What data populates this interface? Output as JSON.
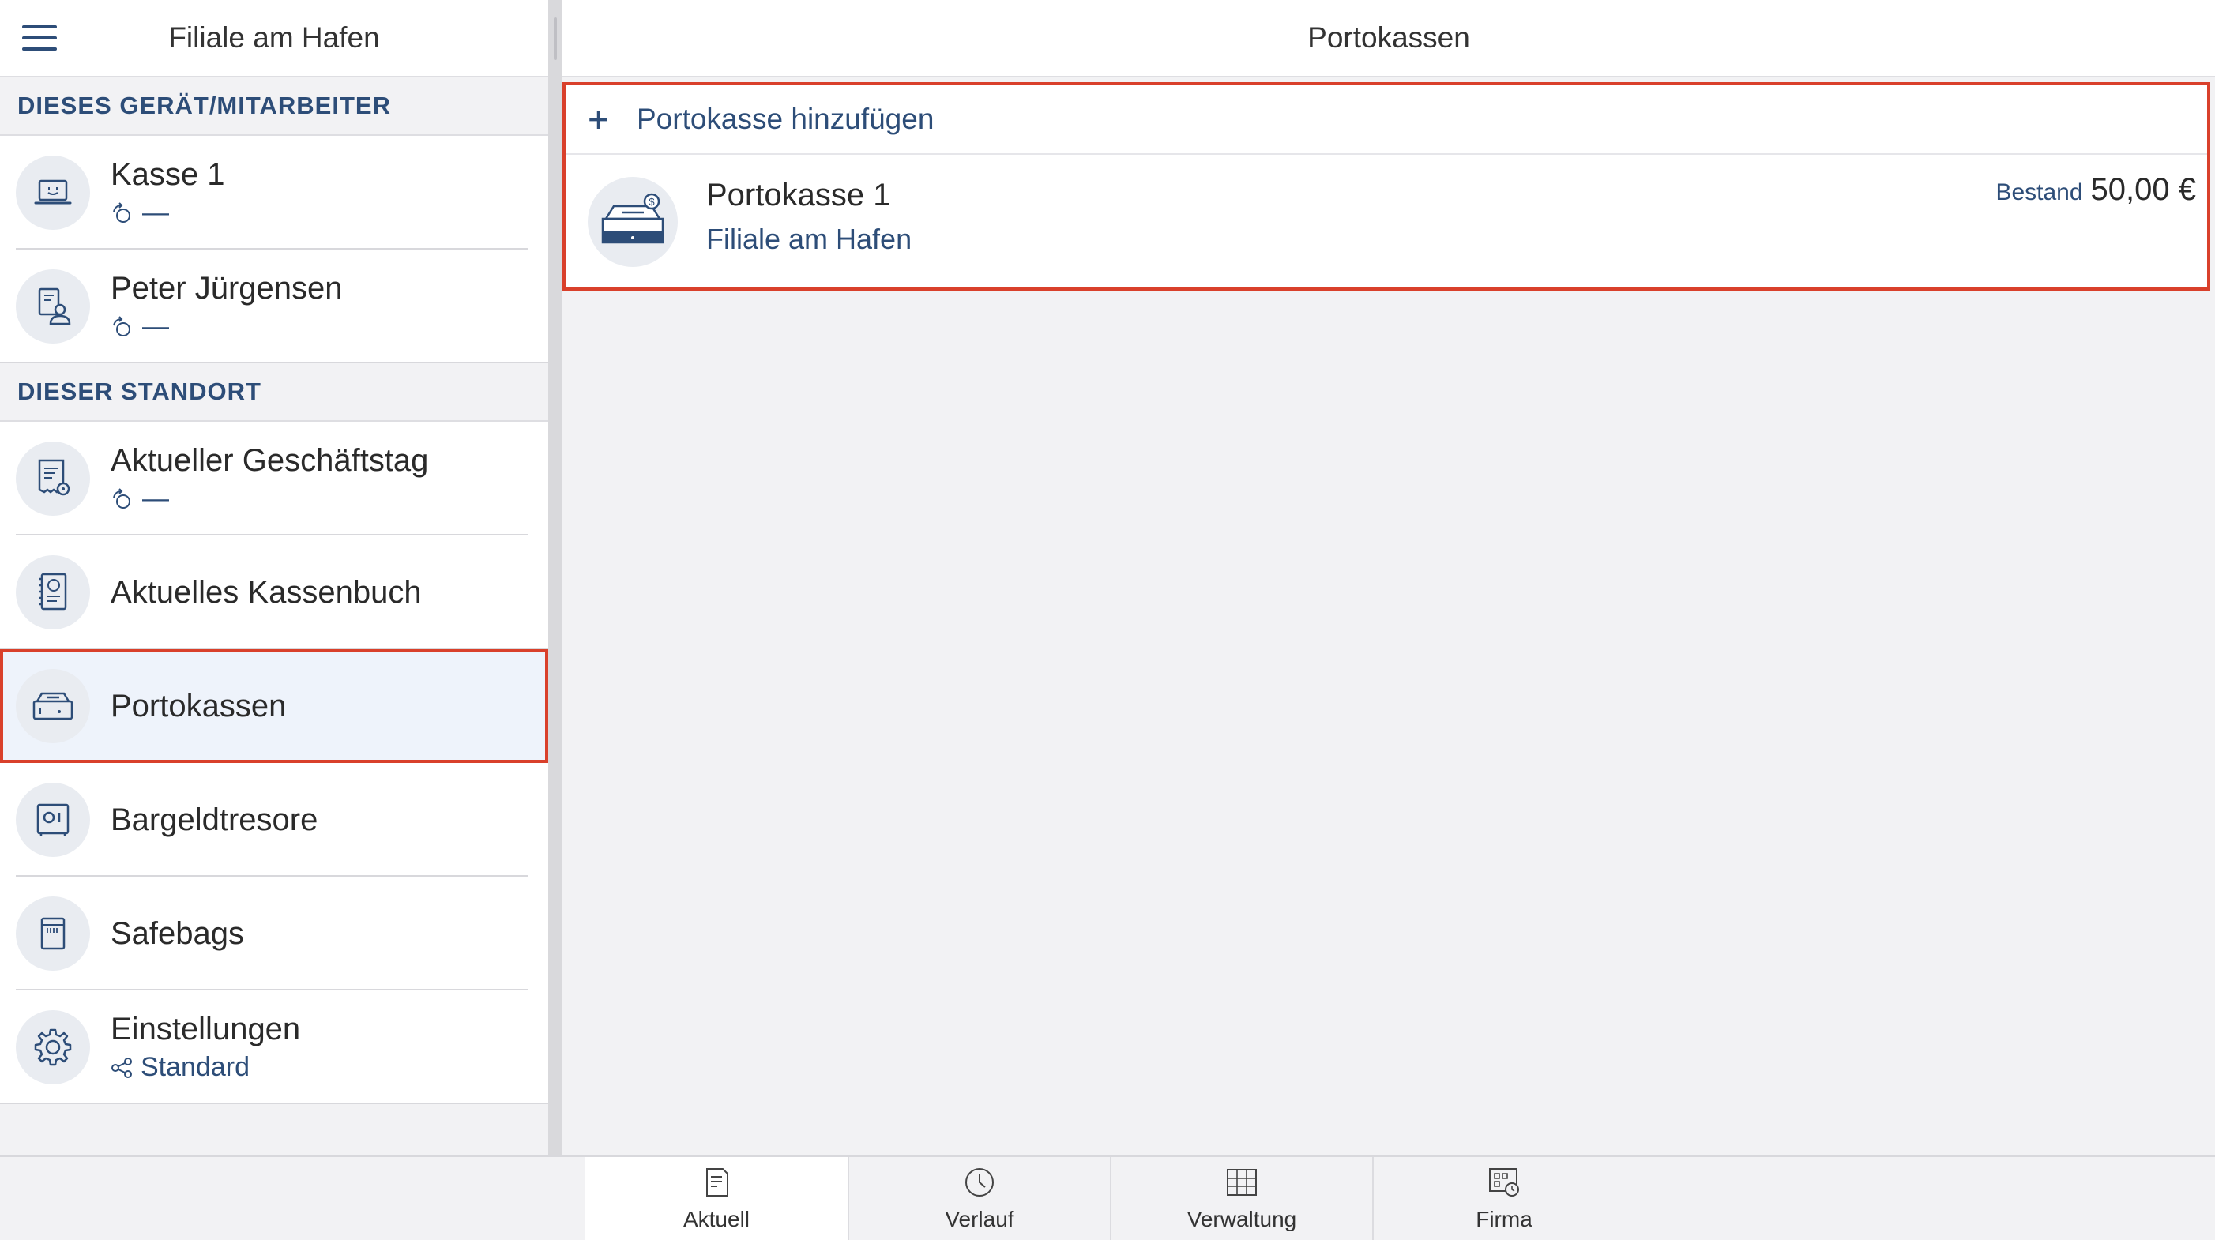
{
  "sidebar": {
    "header_title": "Filiale am Hafen",
    "section_device": "DIESES GERÄT/MITARBEITER",
    "section_location": "DIESER STANDORT",
    "items": [
      {
        "title": "Kasse 1",
        "sub": "—",
        "icon": "laptop-icon"
      },
      {
        "title": "Peter Jürgensen",
        "sub": "—",
        "icon": "employee-icon"
      },
      {
        "title": "Aktueller Geschäftstag",
        "sub": "—",
        "icon": "receipt-location-icon"
      },
      {
        "title": "Aktuelles Kassenbuch",
        "icon": "cashbook-icon"
      },
      {
        "title": "Portokassen",
        "icon": "cashbox-icon"
      },
      {
        "title": "Bargeldtresore",
        "icon": "safe-icon"
      },
      {
        "title": "Safebags",
        "icon": "safebag-icon"
      },
      {
        "title": "Einstellungen",
        "sub": "Standard",
        "icon": "gear-icon"
      }
    ]
  },
  "main": {
    "header_title": "Portokassen",
    "add_label": "Portokasse hinzufügen",
    "entries": [
      {
        "title": "Portokasse 1",
        "location": "Filiale am Hafen",
        "balance_label": "Bestand",
        "balance_value": "50,00 €",
        "icon": "cashbox-icon"
      }
    ]
  },
  "tabs": [
    {
      "label": "Aktuell",
      "icon": "document-icon",
      "active": true
    },
    {
      "label": "Verlauf",
      "icon": "clock-icon"
    },
    {
      "label": "Verwaltung",
      "icon": "grid-icon"
    },
    {
      "label": "Firma",
      "icon": "company-icon"
    }
  ],
  "colors": {
    "accent": "#2d4d78",
    "highlight": "#d9402b",
    "background": "#f2f2f4"
  }
}
